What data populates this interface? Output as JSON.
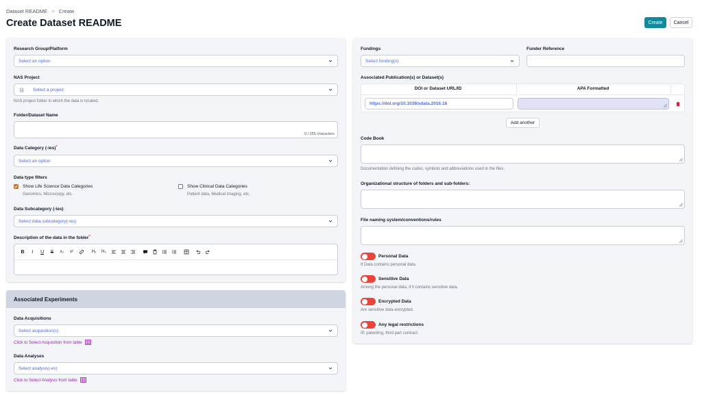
{
  "breadcrumb": {
    "root": "Dataset README",
    "separator": ">",
    "current": "Create"
  },
  "page": {
    "title": "Create Dataset README"
  },
  "actions": {
    "create_label": "Create",
    "cancel_label": "Cancel"
  },
  "colors": {
    "primary": "#0f8a9d",
    "toggle_off": "#e8453c",
    "link": "#9b27af",
    "checkbox_on": "#c2782f",
    "placeholder": "#4f6bd8"
  },
  "left": {
    "research_group": {
      "label": "Research Group/Platform",
      "placeholder": "Select an option"
    },
    "nas_project": {
      "label": "NAS Project",
      "placeholder": "Select a project",
      "hint": "NAS project folder in which the data is located.",
      "icon": "file-icon"
    },
    "folder_name": {
      "label": "Folder/Dataset Name",
      "counter": "0 / 255 characters"
    },
    "data_category": {
      "label": "Data Category (-ies)",
      "required": "*",
      "placeholder": "Select an option"
    },
    "filters": {
      "label": "Data type filters",
      "life_science": {
        "label": "Show Life Science Data Categories",
        "hint": "Genomics, Microscopy, etc.",
        "checked": true
      },
      "clinical": {
        "label": "Show Clinical Data Categories",
        "hint": "Patient data, Medical imaging, etc.",
        "checked": false
      }
    },
    "subcategory": {
      "label": "Data Subcategory (-ies)",
      "placeholder": "Select data subcategory(-ies)"
    },
    "description": {
      "label": "Description of the data in the folder",
      "required": "*"
    },
    "editor_toolbar": [
      "B",
      "I",
      "U",
      "S",
      "x₂",
      "x²",
      "link-icon",
      "H₂",
      "H₃",
      "align-left-icon",
      "align-center-icon",
      "align-right-icon",
      "comment-icon",
      "clipboard-icon",
      "bullet-list-icon",
      "ordered-list-icon",
      "table-icon",
      "undo-icon",
      "redo-icon"
    ]
  },
  "experiments": {
    "title": "Associated Experiments",
    "acquisitions": {
      "label": "Data Acquisitions",
      "placeholder": "Select acquisition(s)",
      "link": "Click to Select Acquisition from table"
    },
    "analyses": {
      "label": "Data Analyses",
      "placeholder": "Select analysis(-es)",
      "link": "Click to Select Analysis from table"
    }
  },
  "right": {
    "fundings": {
      "label": "Fundings",
      "placeholder": "Select funding(s)"
    },
    "funder_reference": {
      "label": "Funder Reference"
    },
    "publications": {
      "label": "Associated Publication(s) or Dataset(s)",
      "col_doi": "DOI or Dataset URL/ID",
      "col_apa": "APA Formatted",
      "row_doi": "https://doi.org/10.1038/sdata.2016.18",
      "add_label": "Add another"
    },
    "code_book": {
      "label": "Code Book",
      "hint": "Documentation defining the codes, symbols and abbreviations used in the files."
    },
    "org_structure": {
      "label": "Organizational structure of folders and sub-folders:"
    },
    "naming": {
      "label": "File naming system/conventions/rules"
    },
    "toggles": [
      {
        "label": "Personal Data",
        "hint": "If Data contains personal data."
      },
      {
        "label": "Sensitive Data",
        "hint": "Among the personal data, if it contains sensitive data."
      },
      {
        "label": "Encrypted Data",
        "hint": "Are sensitive data encrypted."
      },
      {
        "label": "Any legal restrictions",
        "hint": "IP, patenting, third part contract."
      }
    ]
  }
}
